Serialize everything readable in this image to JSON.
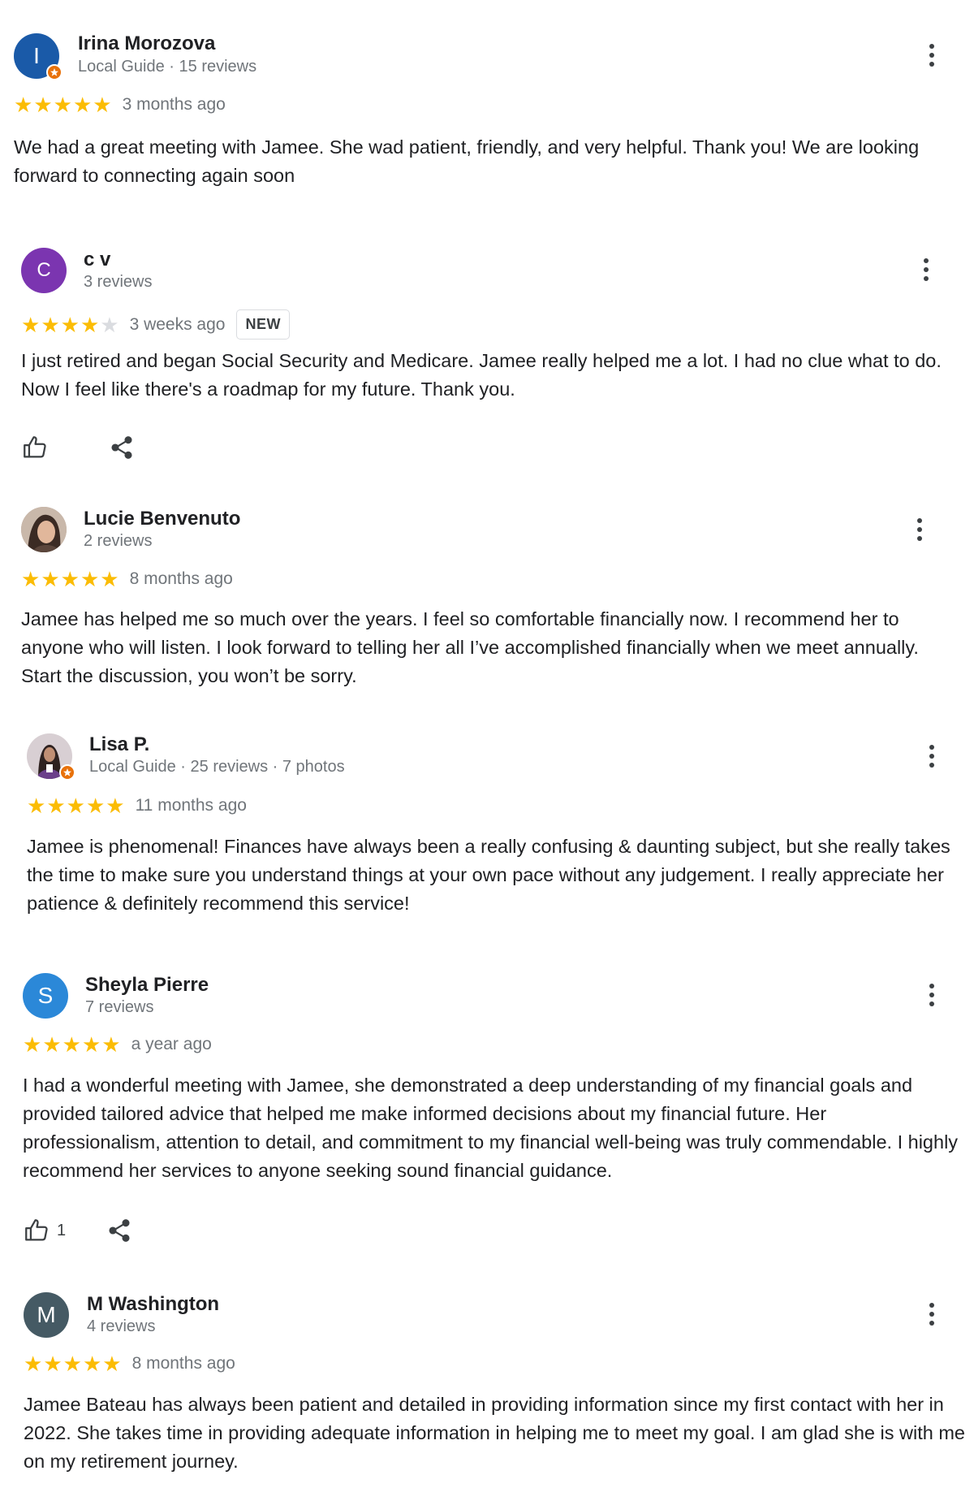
{
  "reviews": [
    {
      "name": "Irina Morozova",
      "avatar_letter": "I",
      "avatar_color": "#1a5aa8",
      "subtitle": "Local Guide · 15 reviews",
      "rating": 5,
      "date": "3 months ago",
      "badge": "",
      "text": "We had a great meeting with Jamee. She wad patient, friendly, and very helpful. Thank you! We are looking forward to connecting again soon",
      "likes": ""
    },
    {
      "name": "c v",
      "avatar_letter": "C",
      "avatar_color": "#7b35b0",
      "subtitle": "3 reviews",
      "rating": 4,
      "date": "3 weeks ago",
      "badge": "NEW",
      "text": "I just retired and began Social Security and Medicare. Jamee really helped me a lot. I had no clue what to do. Now I feel like there's a roadmap for my future. Thank you.",
      "likes": ""
    },
    {
      "name": "Lucie Benvenuto",
      "avatar_letter": "",
      "avatar_color": "#6d5a4e",
      "subtitle": "2 reviews",
      "rating": 5,
      "date": "8 months ago",
      "badge": "",
      "text": "Jamee has helped me so much over the years. I feel so comfortable financially now. I recommend her to anyone who will listen. I look forward to telling her all I’ve accomplished financially when we meet annually. Start the discussion, you won’t be sorry.",
      "likes": ""
    },
    {
      "name": "Lisa P.",
      "avatar_letter": "",
      "avatar_color": "#8a6a8f",
      "subtitle": "Local Guide · 25 reviews · 7 photos",
      "rating": 5,
      "date": "11 months ago",
      "badge": "",
      "text": "Jamee is phenomenal! Finances have always been a really confusing & daunting subject, but she really takes the time to make sure you understand things at your own pace without any judgement. I really appreciate her patience & definitely recommend this service!",
      "likes": ""
    },
    {
      "name": "Sheyla Pierre",
      "avatar_letter": "S",
      "avatar_color": "#2b88d8",
      "subtitle": "7 reviews",
      "rating": 5,
      "date": "a year ago",
      "badge": "",
      "text": "I had a wonderful meeting with Jamee, she demonstrated a deep understanding of my financial goals and provided tailored advice that helped me make informed decisions about my financial future. Her professionalism, attention to detail, and commitment to my financial well-being was truly commendable. I highly recommend her services to anyone seeking sound financial guidance.",
      "likes": "1"
    },
    {
      "name": "M Washington",
      "avatar_letter": "M",
      "avatar_color": "#455a64",
      "subtitle": "4 reviews",
      "rating": 5,
      "date": "8 months ago",
      "badge": "",
      "text": "Jamee Bateau has always been patient and detailed in providing information since my first contact with her in 2022. She takes time in providing adequate information in helping me to meet my goal. I am glad she is with me on my retirement journey.",
      "likes": ""
    }
  ]
}
